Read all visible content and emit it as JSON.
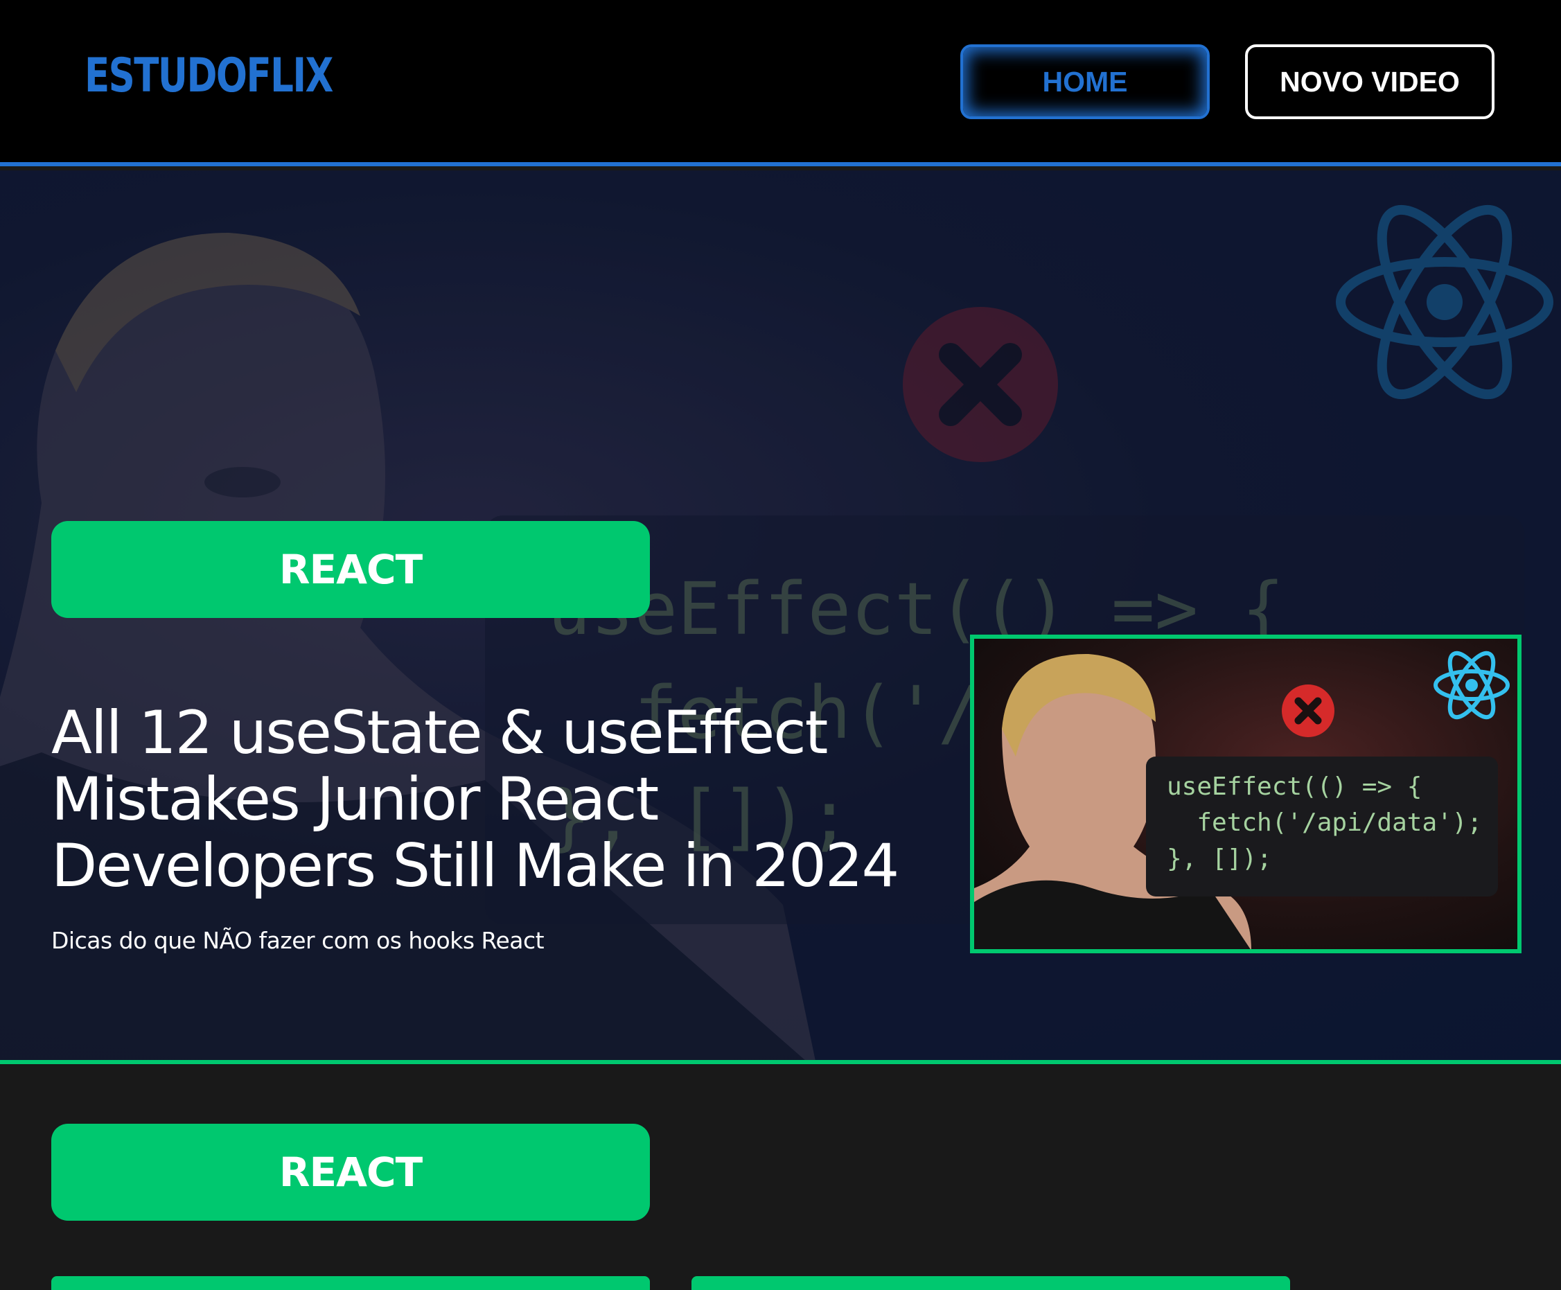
{
  "header": {
    "logo": "ESTUDOFLIX",
    "nav": {
      "home": "HOME",
      "new_video": "NOVO VIDEO"
    }
  },
  "hero": {
    "category": "REACT",
    "title": "All 12 useState & useEffect Mistakes Junior React Developers Still Make in 2024",
    "description": "Dicas do que NÃO fazer com os hooks React",
    "bg_code_lines": [
      "useEffect(() => {",
      "  fetch('/",
      "}, []);"
    ],
    "thumbnail": {
      "code_lines": [
        "useEffect(() => {",
        "  fetch('/api/data');",
        "}, []);"
      ]
    }
  },
  "section": {
    "category": "REACT"
  },
  "colors": {
    "brand_blue": "#2271d1",
    "react_green": "#00c86f",
    "header_bg": "#000000",
    "page_bg": "#191919"
  },
  "icons": [
    "react-atom-icon",
    "close-x-icon"
  ]
}
